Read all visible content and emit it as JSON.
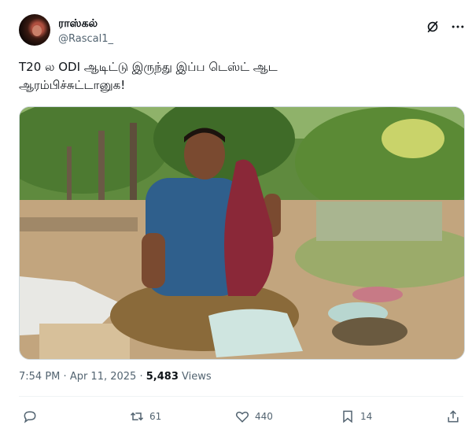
{
  "author": {
    "display_name": "ராஸ்கல்",
    "handle": "@Rascal1_"
  },
  "icons": {
    "grok": "grok-icon",
    "more": "more-options-icon",
    "reply": "reply-icon",
    "retweet": "retweet-icon",
    "like": "like-icon",
    "bookmark": "bookmark-icon",
    "share": "share-icon"
  },
  "tweet": {
    "text": "T20 ல ODI ஆடிட்டு இருந்து இப்ப டெஸ்ட் ஆட\nஆரம்பிச்சுட்டானுக!"
  },
  "meta": {
    "time": "7:54 PM",
    "date": "Apr 11, 2025",
    "views_count": "5,483",
    "views_label": "Views",
    "separator": "·"
  },
  "stats": {
    "reply_count": "",
    "retweet_count": "61",
    "like_count": "440",
    "bookmark_count": "14"
  },
  "colors": {
    "text_primary": "#0f1419",
    "text_secondary": "#536471",
    "border": "#cfd9de"
  }
}
